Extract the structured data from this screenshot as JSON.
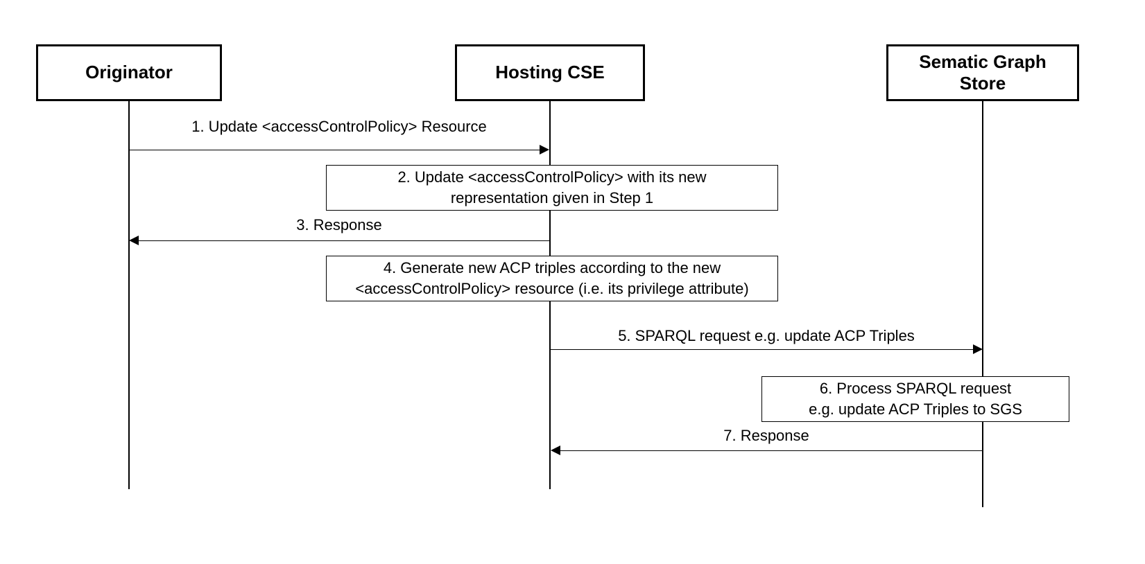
{
  "actors": {
    "originator": "Originator",
    "hosting_cse": "Hosting CSE",
    "semantic_store": "Sematic Graph\nStore"
  },
  "messages": {
    "m1": "1. Update <accessControlPolicy> Resource",
    "m2": "2. Update <accessControlPolicy> with its new\nrepresentation given in Step 1",
    "m3": "3. Response",
    "m4": "4. Generate new ACP triples according to the new\n<accessControlPolicy> resource (i.e. its  privilege attribute)",
    "m5": "5. SPARQL request e.g. update ACP Triples",
    "m6": "6. Process SPARQL request\ne.g. update ACP Triples to SGS",
    "m7": "7. Response"
  }
}
